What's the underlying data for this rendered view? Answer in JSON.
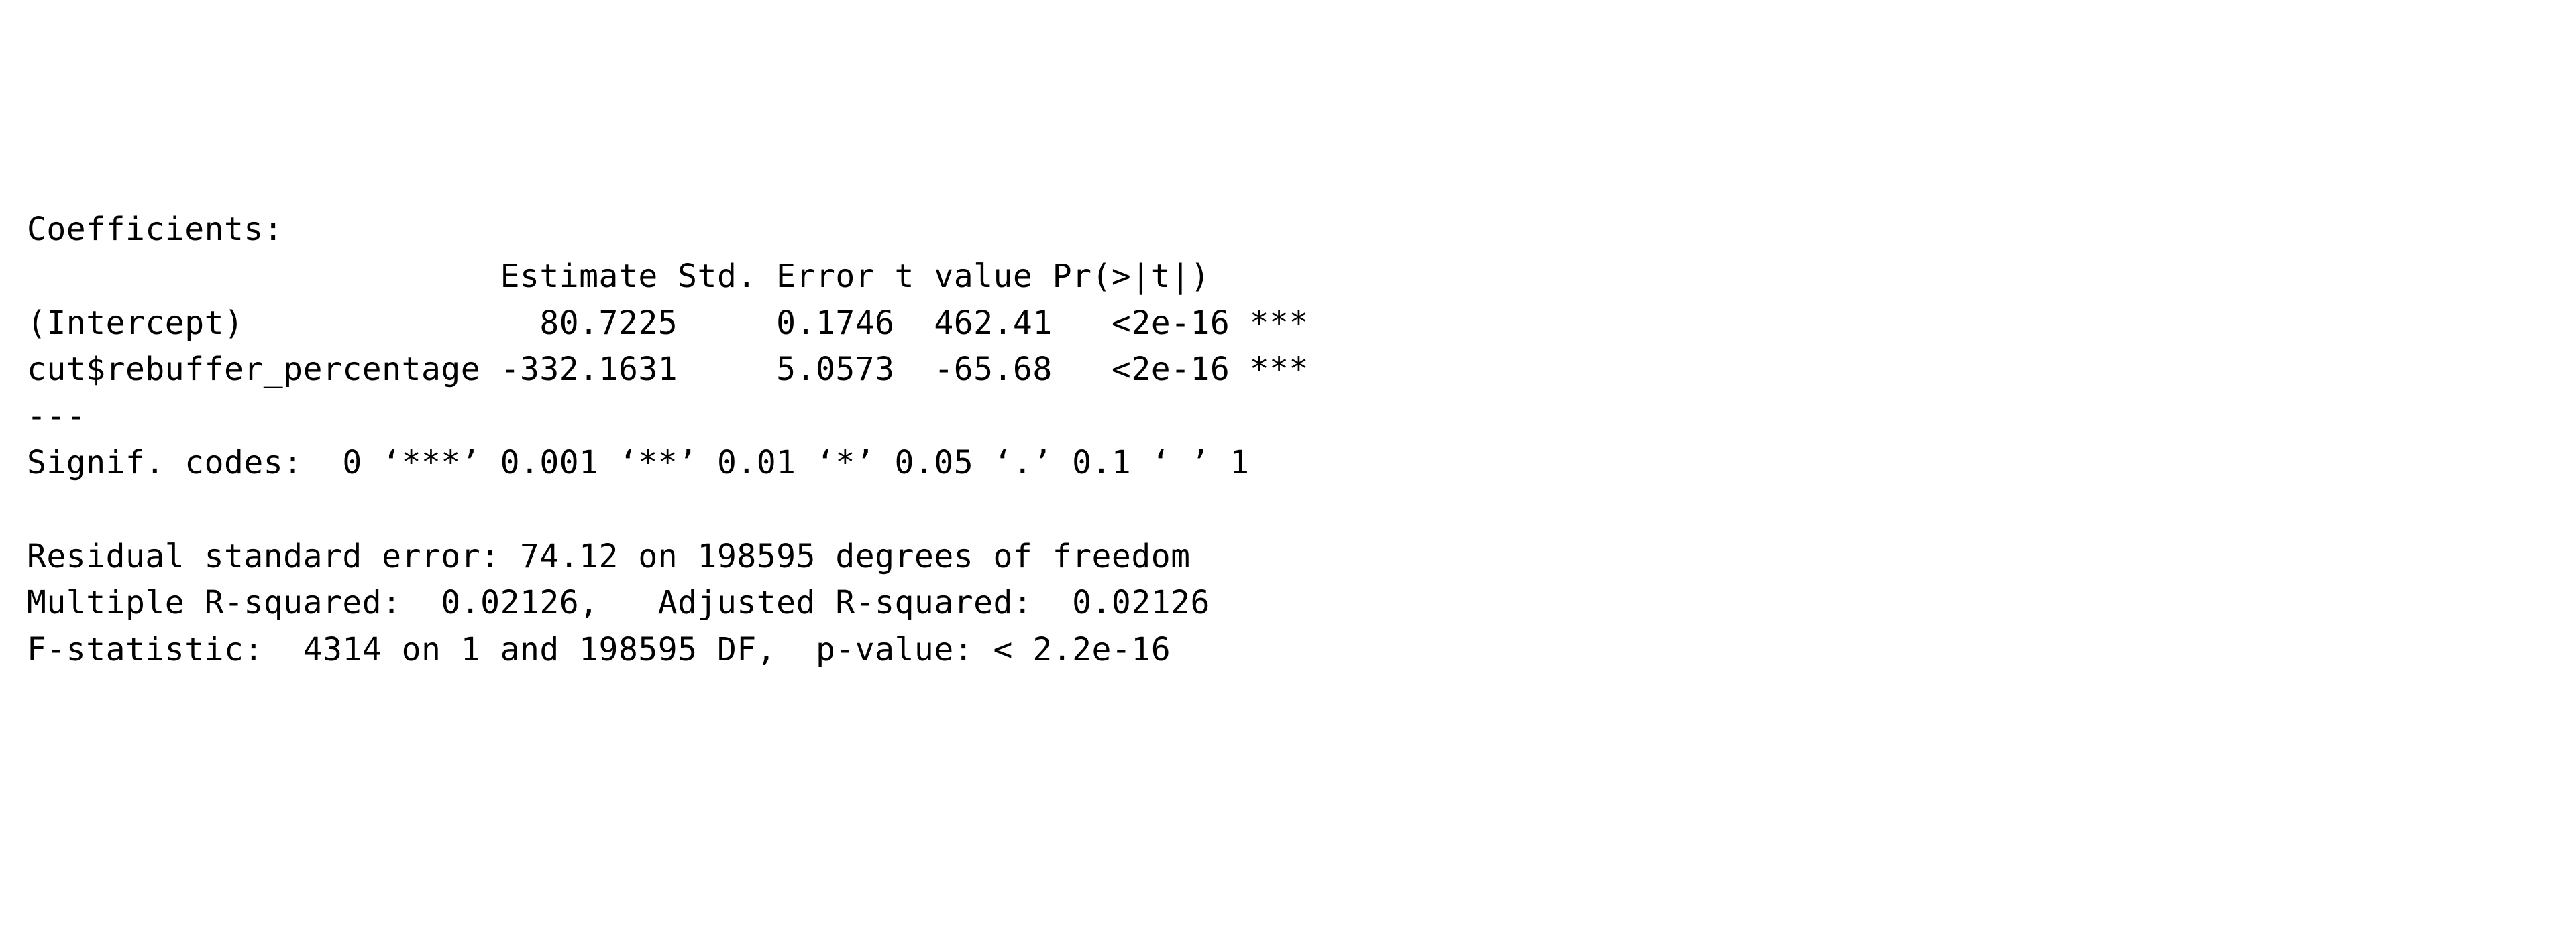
{
  "header": {
    "title": "Coefficients:",
    "columns": "                        Estimate Std. Error t value Pr(>|t|)"
  },
  "rows": [
    {
      "name": "(Intercept)",
      "estimate": "80.7225",
      "stderr": "0.1746",
      "tvalue": "462.41",
      "pvalue": "<2e-16",
      "signif": "***"
    },
    {
      "name": "cut$rebuffer_percentage",
      "estimate": "-332.1631",
      "stderr": "5.0573",
      "tvalue": "-65.68",
      "pvalue": "<2e-16",
      "signif": "***"
    }
  ],
  "divider": "---",
  "signif_codes": "Signif. codes:  0 ‘***’ 0.001 ‘**’ 0.01 ‘*’ 0.05 ‘.’ 0.1 ‘ ’ 1",
  "footer": {
    "rse": "Residual standard error: 74.12 on 198595 degrees of freedom",
    "r2": "Multiple R-squared:  0.02126,\tAdjusted R-squared:  0.02126",
    "fstat": "F-statistic:  4314 on 1 and 198595 DF,  p-value: < 2.2e-16"
  },
  "formatted_lines": {
    "row0": "(Intercept)               80.7225     0.1746  462.41   <2e-16 ***",
    "row1": "cut$rebuffer_percentage -332.1631     5.0573  -65.68   <2e-16 ***"
  }
}
